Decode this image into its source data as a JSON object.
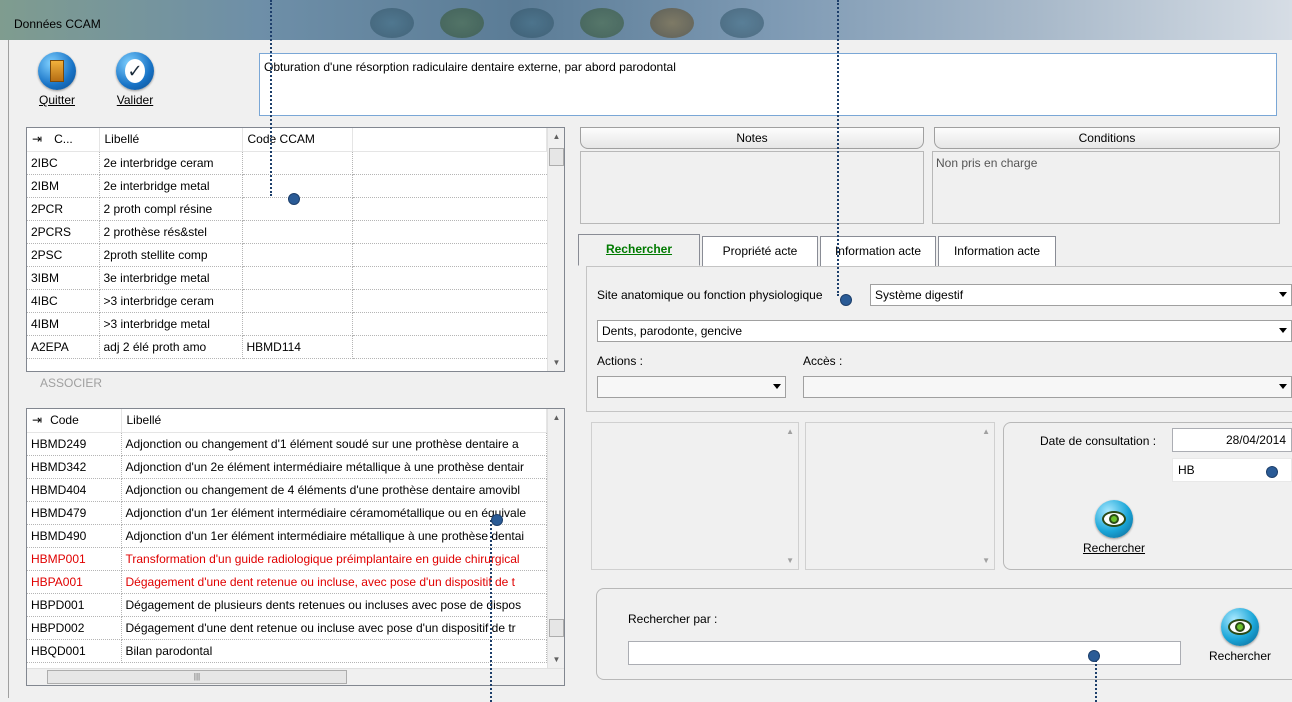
{
  "window": {
    "title": "Données CCAM"
  },
  "toolbar": {
    "quit_label": "Quitter",
    "validate_label": "Valider"
  },
  "description": "Obturation d'une résorption radiculaire dentaire externe, par abord parodontal",
  "top_grid": {
    "headers": [
      "C...",
      "Libellé",
      "Code CCAM"
    ],
    "rows": [
      [
        "2IBC",
        "2e interbridge ceram",
        ""
      ],
      [
        "2IBM",
        "2e interbridge metal",
        ""
      ],
      [
        "2PCR",
        "2 proth compl résine",
        ""
      ],
      [
        "2PCRS",
        "2 prothèse rés&stel",
        ""
      ],
      [
        "2PSC",
        "2proth stellite comp",
        ""
      ],
      [
        "3IBM",
        "3e interbridge metal",
        ""
      ],
      [
        "4IBC",
        ">3 interbridge ceram",
        ""
      ],
      [
        "4IBM",
        ">3 interbridge metal",
        ""
      ],
      [
        "A2EPA",
        "adj 2 élé proth amo",
        "HBMD114"
      ]
    ]
  },
  "associate_label": "ASSOCIER",
  "bottom_grid": {
    "headers": [
      "Code",
      "Libellé"
    ],
    "rows": [
      {
        "code": "HBMD249",
        "label": "Adjonction ou changement d'1 élément soudé sur une prothèse dentaire a",
        "red": false
      },
      {
        "code": "HBMD342",
        "label": "Adjonction d'un 2e élément intermédiaire métallique à une prothèse dentair",
        "red": false
      },
      {
        "code": "HBMD404",
        "label": "Adjonction ou changement de 4 éléments d'une prothèse dentaire amovibl",
        "red": false
      },
      {
        "code": "HBMD479",
        "label": "Adjonction d'un 1er élément intermédiaire céramométallique ou en équivale",
        "red": false
      },
      {
        "code": "HBMD490",
        "label": "Adjonction d'un 1er élément intermédiaire métallique à une prothèse dentai",
        "red": false
      },
      {
        "code": "HBMP001",
        "label": "Transformation d'un guide radiologique préimplantaire en guide chirurgical",
        "red": true
      },
      {
        "code": "HBPA001",
        "label": "Dégagement d'une dent retenue ou incluse, avec pose d'un dispositif de t",
        "red": true
      },
      {
        "code": "HBPD001",
        "label": "Dégagement de plusieurs dents retenues ou incluses avec pose de dispos",
        "red": false
      },
      {
        "code": "HBPD002",
        "label": "Dégagement d'une dent retenue ou incluse avec pose d'un dispositif de tr",
        "red": false
      },
      {
        "code": "HBQD001",
        "label": "Bilan parodontal",
        "red": false
      }
    ]
  },
  "notes": {
    "title": "Notes",
    "content": ""
  },
  "conditions": {
    "title": "Conditions",
    "content": "Non pris en charge"
  },
  "tabs": [
    {
      "label": "Rechercher",
      "active": true
    },
    {
      "label": "Propriété acte",
      "active": false
    },
    {
      "label": "Information acte",
      "active": false
    },
    {
      "label": "Information acte",
      "active": false
    }
  ],
  "search": {
    "site_label": "Site anatomique ou fonction physiologique",
    "site_value": "Système digestif",
    "sub_value": "Dents, parodonte, gencive",
    "actions_label": "Actions :",
    "actions_value": "",
    "access_label": "Accès :",
    "access_value": ""
  },
  "consultation": {
    "date_label": "Date de consultation :",
    "date_value": "28/04/2014",
    "code_value": "HB",
    "search_button": "Rechercher"
  },
  "search_by": {
    "label": "Rechercher par :",
    "value": "",
    "button": "Rechercher"
  },
  "colors": {
    "accent_dot": "#2a5b96",
    "red_text": "#e00000",
    "active_tab": "#007a00"
  }
}
